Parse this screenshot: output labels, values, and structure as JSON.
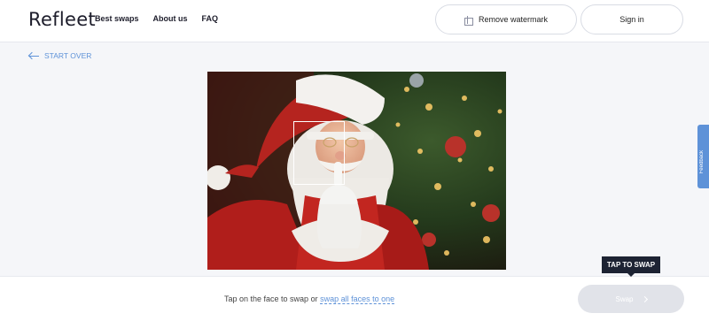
{
  "header": {
    "logo": "Refleet",
    "nav": [
      "Best swaps",
      "About us",
      "FAQ"
    ],
    "remove_watermark": "Remove watermark",
    "sign_in": "Sign in"
  },
  "start_over": "START OVER",
  "feedback": "Feedback",
  "bottom": {
    "hint_text": "Tap on the face to swap or ",
    "hint_link": "swap all faces to one",
    "swap_button": "Swap",
    "tooltip": "TAP TO SWAP"
  },
  "icons": {
    "logo": "logo",
    "remove_watermark": "gift-icon",
    "start_over": "arrow-left-icon",
    "swap": "chevron-right-icon",
    "feedback": "feedback-icon"
  },
  "colors": {
    "accent": "#5e92d8",
    "tooltip_bg": "#1d2333",
    "swap_disabled": "#e1e3e9"
  }
}
